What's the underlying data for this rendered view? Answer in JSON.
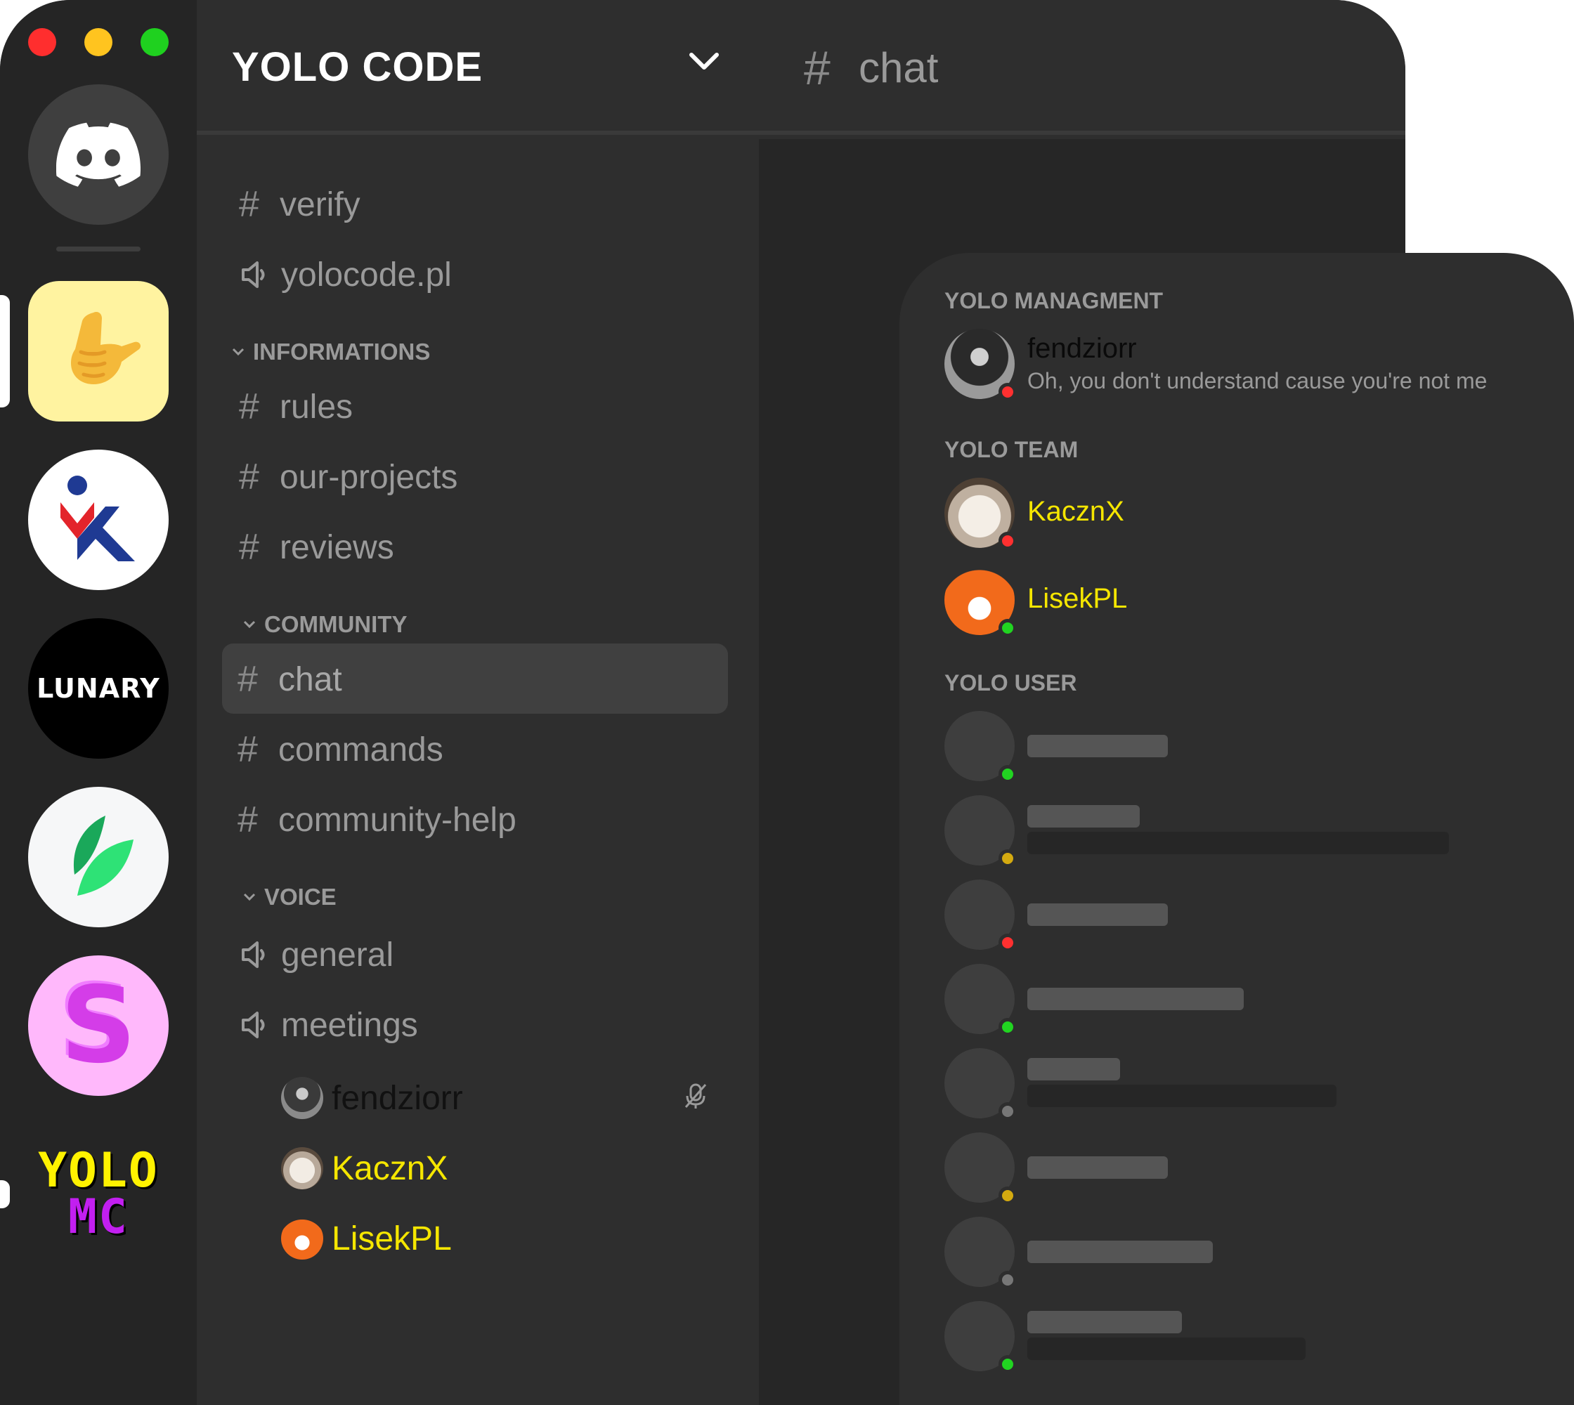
{
  "server": {
    "name": "YOLO CODE"
  },
  "channels": {
    "top": [
      {
        "type": "text",
        "name": "verify"
      },
      {
        "type": "voice",
        "name": "yolocode.pl"
      }
    ],
    "informations": {
      "label": "INFORMATIONS",
      "items": [
        {
          "name": "rules"
        },
        {
          "name": "our-projects"
        },
        {
          "name": "reviews"
        }
      ]
    },
    "community": {
      "label": "COMMUNITY",
      "items": [
        {
          "name": "chat",
          "active": true
        },
        {
          "name": "commands"
        },
        {
          "name": "community-help"
        }
      ]
    },
    "voice": {
      "label": "VOICE",
      "items": [
        {
          "name": "general"
        },
        {
          "name": "meetings"
        }
      ],
      "connected": [
        {
          "name": "fendziorr",
          "color": "#000000",
          "muted": true
        },
        {
          "name": "KacznX",
          "color": "#f5e600"
        },
        {
          "name": "LisekPL",
          "color": "#f5e600"
        }
      ]
    }
  },
  "hash_symbol": "#",
  "chat": {
    "channel": "chat"
  },
  "servers": {
    "lunary": "LUNARY",
    "yolomc_line1": "YOLO",
    "yolomc_line2": "MC",
    "s_letter": "S"
  },
  "members": {
    "management": {
      "label": "YOLO MANAGMENT",
      "users": [
        {
          "name": "fendziorr",
          "status_text": "Oh, you don't understand cause you're not me",
          "presence": "dnd",
          "color": "#000000"
        }
      ]
    },
    "team": {
      "label": "YOLO TEAM",
      "users": [
        {
          "name": "KacznX",
          "presence": "dnd",
          "color": "#f5e600"
        },
        {
          "name": "LisekPL",
          "presence": "online",
          "color": "#f5e600"
        }
      ]
    },
    "users": {
      "label": "YOLO USER",
      "placeholders": [
        {
          "presence": "online"
        },
        {
          "presence": "idle"
        },
        {
          "presence": "dnd"
        },
        {
          "presence": "online"
        },
        {
          "presence": "offline"
        },
        {
          "presence": "idle"
        },
        {
          "presence": "offline"
        },
        {
          "presence": "online"
        }
      ]
    }
  },
  "colors": {
    "accent_yellow": "#f5e600",
    "status_dnd": "#ff3030",
    "status_online": "#21d421",
    "status_idle": "#d4aa10",
    "status_offline": "#777777"
  },
  "icons": [
    "discord-icon",
    "shaka-hand-icon",
    "mk-logo-icon",
    "leaf-icon",
    "speaker-icon",
    "chevron-down-icon",
    "mic-muted-icon"
  ]
}
